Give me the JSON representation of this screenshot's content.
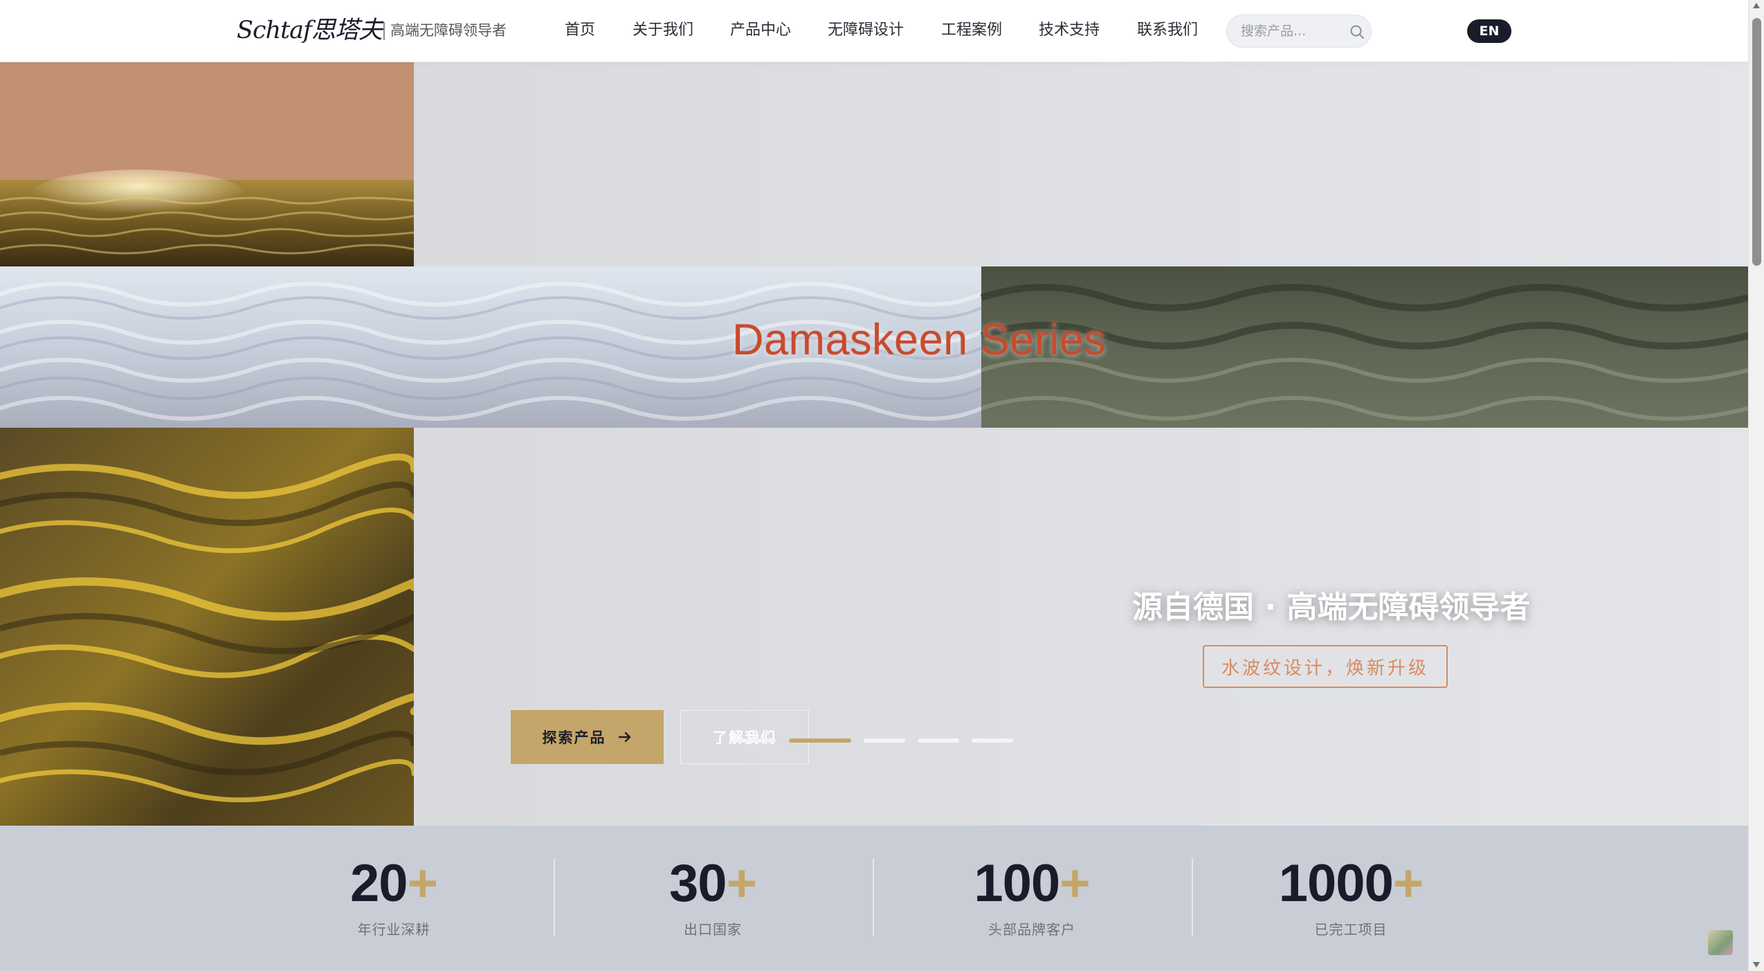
{
  "header": {
    "logo": "Schtaf思塔夫",
    "tagline": "高端无障碍领导者",
    "nav": [
      {
        "label": "首页"
      },
      {
        "label": "关于我们"
      },
      {
        "label": "产品中心"
      },
      {
        "label": "无障碍设计"
      },
      {
        "label": "工程案例"
      },
      {
        "label": "技术支持"
      },
      {
        "label": "联系我们"
      }
    ],
    "search": {
      "placeholder": "搜索产品..."
    },
    "lang": "EN"
  },
  "hero": {
    "series_title": "Damaskeen Series",
    "heading": "源自德国 · 高端无障碍领导者",
    "subheading": "水波纹设计，焕新升级",
    "buttons": {
      "explore": "探索产品",
      "about": "了解我们"
    },
    "slides": {
      "count": 5,
      "active_index": 1
    }
  },
  "stats": [
    {
      "value": "20",
      "suffix": "+",
      "label": "年行业深耕"
    },
    {
      "value": "30",
      "suffix": "+",
      "label": "出口国家"
    },
    {
      "value": "100",
      "suffix": "+",
      "label": "头部品牌客户"
    },
    {
      "value": "1000",
      "suffix": "+",
      "label": "已完工项目"
    }
  ],
  "colors": {
    "accent_gold": "#c5a66a",
    "dark_navy": "#1b1c2b",
    "series_red": "#c94a2c",
    "subheading_orange": "#d98a5f",
    "stats_background": "#c9cdd6"
  },
  "icons": {
    "search": "search-icon",
    "arrow": "arrow-right-icon"
  }
}
